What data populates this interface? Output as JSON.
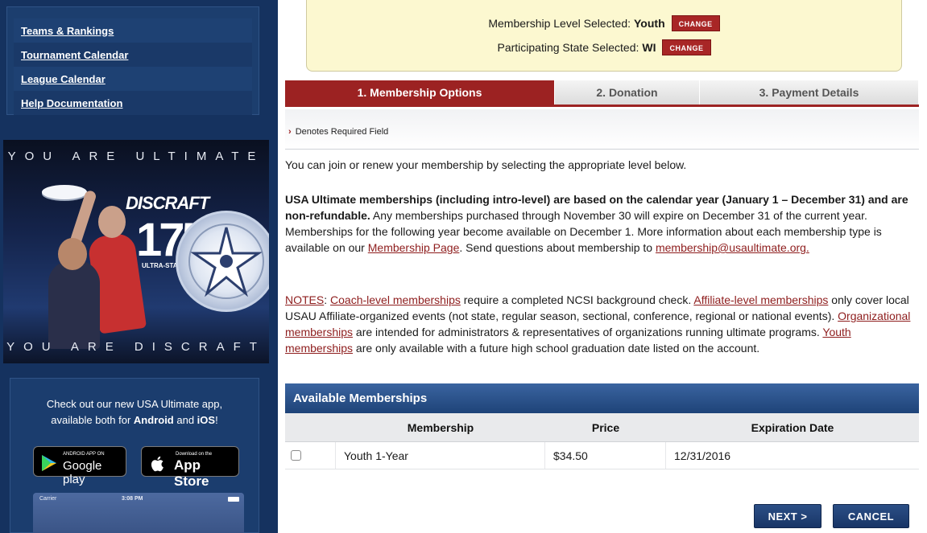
{
  "sidebar": {
    "nav": [
      {
        "label": "Teams & Rankings"
      },
      {
        "label": "Tournament Calendar"
      },
      {
        "label": "League Calendar"
      },
      {
        "label": "Help Documentation"
      }
    ],
    "ad": {
      "top_text": "YOU ARE ULTIMATE",
      "bottom_text": "YOU ARE DISCRAFT",
      "brand": "DISCRAFT",
      "model_number": "175",
      "model_name": "ULTRA-STAR"
    },
    "app": {
      "line1": "Check out our new USA Ultimate app,",
      "line2_prefix": "available both for ",
      "android": "Android",
      "and": " and ",
      "ios": "iOS",
      "bang": "!",
      "google_small": "ANDROID APP ON",
      "google_big": "Google play",
      "apple_small": "Download on the",
      "apple_big": "App Store",
      "phone_carrier": "Carrier",
      "phone_time": "3:08 PM"
    }
  },
  "summary": {
    "level_label": "Membership Level Selected:",
    "level_value": "Youth",
    "state_label": "Participating State Selected:",
    "state_value": "WI",
    "change_label": "CHANGE"
  },
  "tabs": [
    {
      "label": "1. Membership Options",
      "active": true
    },
    {
      "label": "2. Donation",
      "active": false
    },
    {
      "label": "3. Payment Details",
      "active": false
    }
  ],
  "required_note": {
    "chevron": "›",
    "text": "Denotes Required Field"
  },
  "intro": "You can join or renew your membership by selecting the appropriate level below.",
  "main_text": {
    "bold": "USA Ultimate memberships (including intro-level) are based on the calendar year (January 1 – December 31) and are non-refundable.",
    "rest1": " Any memberships purchased through November 30 will expire on December 31 of the current year. Memberships for the following year become available on December 1. More information about each membership type is available on our ",
    "link1": "Membership Page",
    "rest2": ". Send questions about membership to ",
    "link2": "membership@usaultimate.org."
  },
  "notes": {
    "label": "NOTES",
    "colon": ": ",
    "coach_link": "Coach-level memberships",
    "coach_text": " require a completed NCSI background check. ",
    "affiliate_link": "Affiliate-level memberships",
    "affiliate_text": " only cover local USAU Affiliate-organized events (not state, regular season, sectional, conference, regional or national events). ",
    "org_link": "Organizational memberships",
    "org_text": " are intended for administrators & representatives of organizations running ultimate programs. ",
    "youth_link": "Youth memberships",
    "youth_text": " are only available with a future high school graduation date listed on the account."
  },
  "available": {
    "title": "Available Memberships",
    "columns": {
      "membership": "Membership",
      "price": "Price",
      "expiration": "Expiration Date"
    },
    "rows": [
      {
        "name": "Youth 1-Year",
        "price": "$34.50",
        "expiration": "12/31/2016",
        "checked": false
      }
    ]
  },
  "buttons": {
    "next": "NEXT >",
    "cancel": "CANCEL"
  },
  "colors": {
    "sidebar_bg": "#15325f",
    "accent_red": "#9c2222",
    "header_blue": "#1e4378",
    "summary_bg": "#fcf8d0"
  }
}
